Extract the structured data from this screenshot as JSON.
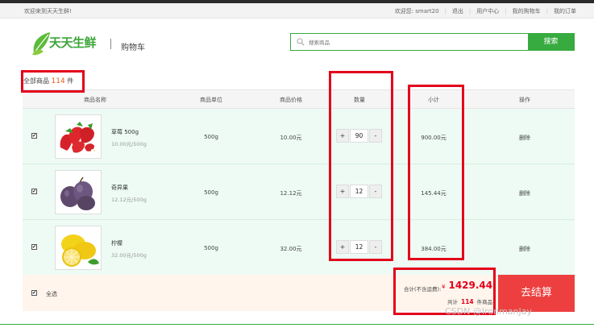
{
  "topbar": {
    "welcome": "欢迎来到天天生鲜!",
    "links": [
      "欢迎您: smart20",
      "退出",
      "用户中心",
      "我的购物车",
      "我的订单"
    ]
  },
  "header": {
    "logo_text": "天天生鲜",
    "page_title": "购物车",
    "search_placeholder": "搜索商品",
    "search_button": "搜索"
  },
  "summary": {
    "label": "全部商品",
    "count": "114",
    "unit": "件"
  },
  "table": {
    "columns": [
      "商品名称",
      "商品单位",
      "商品价格",
      "数量",
      "小计",
      "操作"
    ],
    "rows": [
      {
        "name": "草莓 500g",
        "unit_price": "10.00元/500g",
        "unit": "500g",
        "price": "10.00元",
        "qty": "90",
        "subtotal": "900.00元",
        "action": "删除",
        "image": "strawberry"
      },
      {
        "name": "奇异果",
        "unit_price": "12.12元/500g",
        "unit": "500g",
        "price": "12.12元",
        "qty": "12",
        "subtotal": "145.44元",
        "action": "删除",
        "image": "plum"
      },
      {
        "name": "柠檬",
        "unit_price": "32.00元/500g",
        "unit": "500g",
        "price": "32.00元",
        "qty": "12",
        "subtotal": "384.00元",
        "action": "删除",
        "image": "lemon"
      }
    ],
    "plus": "+",
    "minus": "-",
    "check": "✔"
  },
  "footer": {
    "select_all": "全选",
    "total_label": "合计(不含运费):",
    "currency": "¥",
    "total_amount": "1429.44",
    "count_prefix": "共计",
    "count": "114",
    "count_suffix": "件商品",
    "checkout": "去结算"
  },
  "watermark": "CSDN @IronmanJay",
  "colors": {
    "brand_green": "#37ab40",
    "row_bg": "#edfbf4",
    "footer_bg": "#fff5ec",
    "checkout_red": "#ed3f3f",
    "annotation_red": "#e3001b"
  }
}
